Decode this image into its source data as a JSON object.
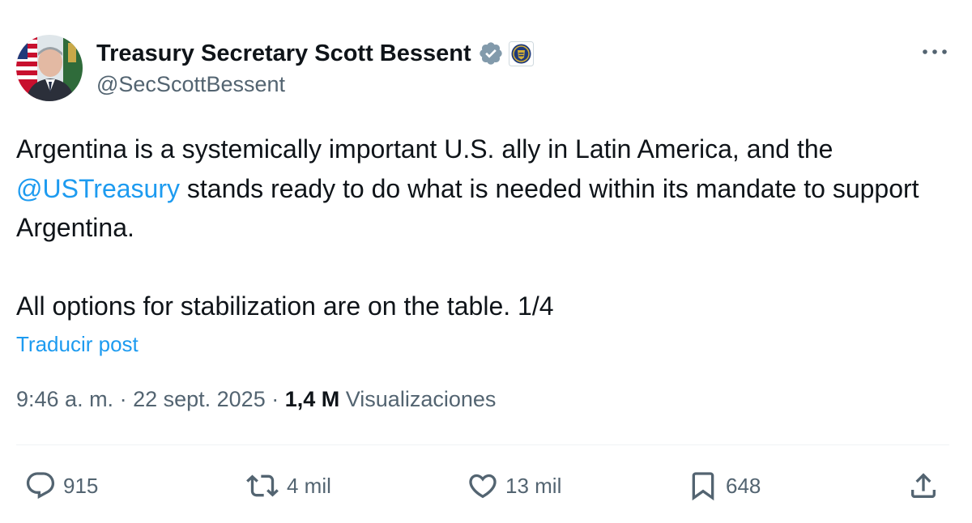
{
  "author": {
    "display_name": "Treasury Secretary Scott Bessent",
    "handle": "@SecScottBessent"
  },
  "post": {
    "text_part1": "Argentina is a systemically important U.S. ally in Latin America, and the ",
    "mention": "@USTreasury",
    "text_part2": " stands ready to do what is needed within its mandate to support Argentina.",
    "text_paragraph2": "All options for stabilization are on the table. 1/4",
    "translate_label": "Traducir post"
  },
  "meta": {
    "time": "9:46 a. m.",
    "separator": " · ",
    "date": "22 sept. 2025",
    "views_count": "1,4 M",
    "views_label": "Visualizaciones"
  },
  "actions": {
    "replies": "915",
    "reposts": "4 mil",
    "likes": "13 mil",
    "bookmarks": "648"
  },
  "colors": {
    "link": "#1d9bf0",
    "text_primary": "#0f1419",
    "text_secondary": "#536471",
    "verified_badge": "#829aab",
    "divider": "#eff3f4"
  },
  "icons": {
    "verified": "verified-badge-icon",
    "affiliate": "treasury-seal-icon",
    "more": "more-dots-icon",
    "reply": "reply-icon",
    "repost": "repost-icon",
    "like": "heart-icon",
    "bookmark": "bookmark-icon",
    "share": "share-icon"
  }
}
